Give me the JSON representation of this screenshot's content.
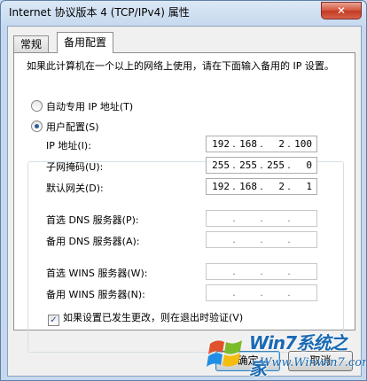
{
  "window": {
    "title": "Internet 协议版本 4 (TCP/IPv4) 属性",
    "close_label": "✕"
  },
  "tabs": [
    {
      "label": "常规",
      "active": false
    },
    {
      "label": "备用配置",
      "active": true
    }
  ],
  "description": "如果此计算机在一个以上的网络上使用，请在下面输入备用的 IP 设置。",
  "options": {
    "auto_label": "自动专用 IP 地址(T)",
    "user_label": "用户配置(S)",
    "selected": "user"
  },
  "fields": {
    "ip": {
      "label": "IP 地址(I):",
      "value": [
        "192",
        "168",
        "2",
        "100"
      ]
    },
    "subnet": {
      "label": "子网掩码(U):",
      "value": [
        "255",
        "255",
        "255",
        "0"
      ]
    },
    "gateway": {
      "label": "默认网关(D):",
      "value": [
        "192",
        "168",
        "2",
        "1"
      ]
    },
    "dns1": {
      "label": "首选 DNS 服务器(P):",
      "value": [
        "",
        "",
        "",
        ""
      ]
    },
    "dns2": {
      "label": "备用 DNS 服务器(A):",
      "value": [
        "",
        "",
        "",
        ""
      ]
    },
    "wins1": {
      "label": "首选 WINS 服务器(W):",
      "value": [
        "",
        "",
        "",
        ""
      ]
    },
    "wins2": {
      "label": "备用 WINS 服务器(N):",
      "value": [
        "",
        "",
        "",
        ""
      ]
    }
  },
  "validate": {
    "label": "如果设置已发生更改，则在退出时验证(V)",
    "checked": true
  },
  "buttons": {
    "ok": "确定",
    "cancel": "取消"
  },
  "watermark": {
    "brand": "Win7系统之家",
    "url": "Www.Winwin7.com"
  },
  "colors": {
    "accent": "#2b5f9e",
    "close": "#c23a22"
  }
}
